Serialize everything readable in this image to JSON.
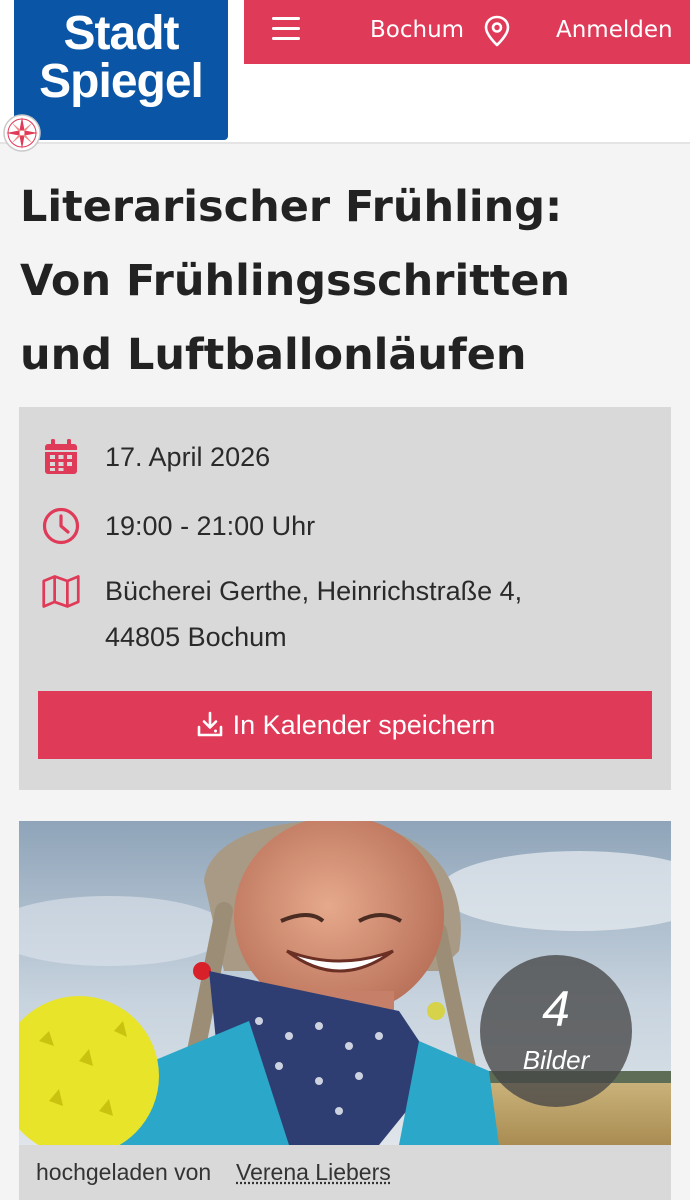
{
  "header": {
    "logo_line1": "Stadt",
    "logo_line2": "Spiegel",
    "menu_icon": "hamburger-menu-icon",
    "city": "Bochum",
    "location_icon": "map-pin-icon",
    "login_label": "Anmelden"
  },
  "article": {
    "title_lines": [
      "Literarischer Frühling:",
      "Von Frühlingsschritten",
      "und Luftballonläufen"
    ]
  },
  "event": {
    "date": "17. April 2026",
    "time": "19:00 - 21:00 Uhr",
    "location_line1": "Bücherei Gerthe, Heinrichstraße 4,",
    "location_line2": "44805 Bochum",
    "save_label": "In Kalender speichern",
    "icons": [
      "calendar-icon",
      "clock-icon",
      "map-icon",
      "download-icon"
    ]
  },
  "gallery": {
    "count": "4",
    "count_label": "Bilder",
    "caption_prefix": "hochgeladen von",
    "author": "Verena Liebers"
  },
  "colors": {
    "accent": "#e03a59",
    "brand_blue": "#0a55a6",
    "info_background": "#d9d9d9",
    "page_background": "#f4f4f4"
  }
}
